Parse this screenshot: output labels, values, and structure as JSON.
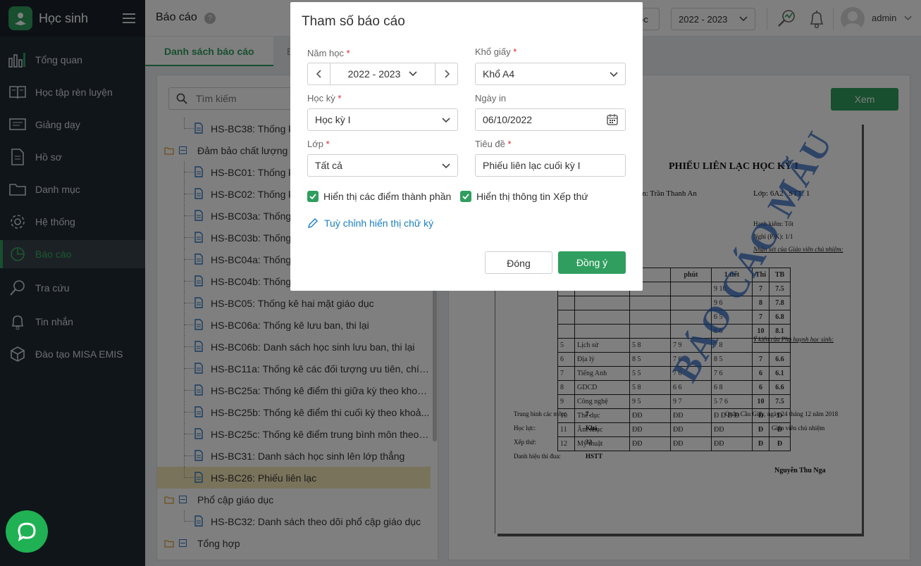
{
  "app": {
    "title": "Học sinh"
  },
  "sidebar": {
    "items": [
      {
        "label": "Tổng quan",
        "icon": "bar-chart-icon"
      },
      {
        "label": "Học tập rèn luyện",
        "icon": "book-icon"
      },
      {
        "label": "Giảng dạy",
        "icon": "blackboard-icon"
      },
      {
        "label": "Hồ sơ",
        "icon": "document-icon"
      },
      {
        "label": "Danh mục",
        "icon": "folder-icon"
      },
      {
        "label": "Hệ thống",
        "icon": "gear-icon"
      },
      {
        "label": "Báo cáo",
        "icon": "pie-chart-icon",
        "active": true
      },
      {
        "label": "Tra cứu",
        "icon": "search-icon"
      },
      {
        "label": "Tin nhắn",
        "icon": "bell-icon"
      },
      {
        "label": "Đào tạo MISA EMIS",
        "icon": "box-icon"
      }
    ]
  },
  "topbar": {
    "page_title": "Báo cáo",
    "help": "?",
    "partial_button": "ọc",
    "year_select": "2022 - 2023",
    "user": "admin"
  },
  "tabs": [
    {
      "label": "Danh sách báo cáo",
      "active": true
    },
    {
      "label": "B"
    }
  ],
  "leftpanel": {
    "search_placeholder": "Tìm kiếm",
    "tree": [
      {
        "type": "file",
        "label": "HS-BC38: Thống kê"
      },
      {
        "type": "group",
        "label": "Đảm bảo chất lượng giáo dục"
      },
      {
        "type": "file",
        "label": "HS-BC01: Thống kê"
      },
      {
        "type": "file",
        "label": "HS-BC02: Thống kê"
      },
      {
        "type": "file",
        "label": "HS-BC03a: Thống kê"
      },
      {
        "type": "file",
        "label": "HS-BC03b: Thống kê"
      },
      {
        "type": "file",
        "label": "HS-BC04a: Thống kê"
      },
      {
        "type": "file",
        "label": "HS-BC04b: Thống kê"
      },
      {
        "type": "file",
        "label": "HS-BC05: Thống kê hai mặt giáo dục"
      },
      {
        "type": "file",
        "label": "HS-BC06a: Thống kê lưu ban, thi lại"
      },
      {
        "type": "file",
        "label": "HS-BC06b: Danh sách học sinh lưu ban, thi lại"
      },
      {
        "type": "file",
        "label": "HS-BC11a: Thống kê các đối tượng ưu tiên, chín..."
      },
      {
        "type": "file",
        "label": "HS-BC25a: Thống kê điểm thi giữa kỳ theo khoả..."
      },
      {
        "type": "file",
        "label": "HS-BC25b: Thống kê điểm thi cuối kỳ theo khoả..."
      },
      {
        "type": "file",
        "label": "HS-BC25c: Thống kê điểm trung bình môn theo k..."
      },
      {
        "type": "file",
        "label": "HS-BC31: Danh sách học sinh lên lớp thẳng"
      },
      {
        "type": "file",
        "label": "HS-BC26: Phiếu liên lạc",
        "selected": true
      },
      {
        "type": "group",
        "label": "Phổ cập giáo dục"
      },
      {
        "type": "file",
        "label": "HS-BC32: Danh sách theo dõi phổ cập giáo dục"
      },
      {
        "type": "group",
        "label": "Tổng hợp"
      }
    ]
  },
  "preview": {
    "view_button": "Xem",
    "title": "PHIẾU LIÊN LẠC HỌC KỲ I",
    "name_line": "ọ tên: Trần Thanh An",
    "class_line": "Lớp: 6A2",
    "stt_line": "STT: 1",
    "headers": [
      "",
      "",
      "",
      "phút",
      "1 tiết",
      "Thi",
      "TB"
    ],
    "grades": [
      [
        "",
        "",
        "",
        "",
        "9 10",
        "7",
        "7.5"
      ],
      [
        "",
        "",
        "",
        "",
        "9 6",
        "8",
        "7.8"
      ],
      [
        "",
        "",
        "",
        "",
        "6 5",
        "7",
        "6.8"
      ],
      [
        "",
        "",
        "",
        "",
        "6 6",
        "10",
        "8.1"
      ],
      [
        "5",
        "Lịch sử",
        "5 8",
        "7 9",
        "7 8",
        "",
        ""
      ],
      [
        "6",
        "Địa lý",
        "8 5",
        "7 6",
        "8 5",
        "7",
        "6.6"
      ],
      [
        "7",
        "Tiếng Anh",
        "5 5",
        "7 6",
        "7 6",
        "6",
        "6.1"
      ],
      [
        "8",
        "GDCD",
        "5 8",
        "6 6",
        "6 8",
        "6",
        "6.6"
      ],
      [
        "9",
        "Công nghệ",
        "9 5",
        "9 7",
        "5 7 6",
        "10",
        "7.5"
      ],
      [
        "10",
        "Thể dục",
        "ĐĐ",
        "ĐĐ",
        "Đ Đ Đ Đ",
        "Đ",
        "Đ"
      ],
      [
        "11",
        "Âm nhạc",
        "ĐĐ",
        "ĐĐ",
        "ĐĐ",
        "Đ",
        "Đ"
      ],
      [
        "12",
        "Mỹ thuật",
        "ĐĐ",
        "ĐĐ",
        "ĐĐ",
        "Đ",
        "Đ"
      ]
    ],
    "side_lines": [
      "Hạnh kiểm: Tốt",
      "Nghỉ (P/K): 1/1",
      "Nhận xét của Giáo viên chủ nhiệm:"
    ],
    "parent_comment": "Ý kiến của Phụ huynh học sinh:",
    "summary": [
      {
        "label": "Trung bình các môn:",
        "value": "7."
      },
      {
        "label": "Học lực:",
        "value": "Khá"
      },
      {
        "label": "Xếp thứ:",
        "value": "32"
      },
      {
        "label": "Danh hiệu thi đua:",
        "value": "HSTT"
      }
    ],
    "place_date": "Quận Cầu Giấy, ngày 24 tháng 12 năm 2018",
    "signer_role": "Giáo viên chủ nhiệm",
    "signer_name": "Nguyễn Thu Nga",
    "watermark": "BÁO CÁO MẪU"
  },
  "modal": {
    "title": "Tham số báo cáo",
    "year_label": "Năm học",
    "year_value": "2022 - 2023",
    "paper_label": "Khổ giấy",
    "paper_value": "Khổ A4",
    "term_label": "Học kỳ",
    "term_value": "Học kỳ I",
    "print_date_label": "Ngày in",
    "print_date_value": "06/10/2022",
    "class_label": "Lớp",
    "class_value": "Tất cả",
    "heading_label": "Tiêu đề",
    "heading_value": "Phiếu liên lạc cuối kỳ I",
    "required_mark": "*",
    "check_components": "Hiển thị các điểm thành phần",
    "check_rank": "Hiển thị thông tin Xếp thứ",
    "customize_signature": "Tuỳ chỉnh hiển thị chữ ký",
    "close_button": "Đóng",
    "ok_button": "Đồng ý"
  },
  "colors": {
    "brand": "#2f9e5e",
    "sidebar": "#212b34",
    "selected_row": "#f5e7b7",
    "link": "#1a7fc1"
  }
}
